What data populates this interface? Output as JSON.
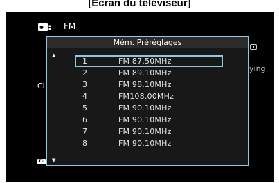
{
  "caption": "[Écran du téléviseur]",
  "header": {
    "source": "FM",
    "icon": "radio-tuner-icon"
  },
  "background_text": {
    "left": "Cl",
    "right": "ying",
    "badge": "TU"
  },
  "dialog": {
    "title": "Mém. Préréglages",
    "scroll_up": "▲",
    "scroll_down": "▼",
    "presets": [
      {
        "num": "1",
        "freq": "FM 87.50MHz",
        "selected": true
      },
      {
        "num": "2",
        "freq": "FM 89.10MHz",
        "selected": false
      },
      {
        "num": "3",
        "freq": "FM 98.10MHz",
        "selected": false
      },
      {
        "num": "4",
        "freq": "FM108.00MHz",
        "selected": false
      },
      {
        "num": "5",
        "freq": "FM 90.10MHz",
        "selected": false
      },
      {
        "num": "6",
        "freq": "FM 90.10MHz",
        "selected": false
      },
      {
        "num": "7",
        "freq": "FM 90.10MHz",
        "selected": false
      },
      {
        "num": "8",
        "freq": "FM 90.10MHz",
        "selected": false
      }
    ]
  },
  "colors": {
    "accent": "#8fc8e6",
    "screen": "#000000",
    "panel": "#181818"
  }
}
